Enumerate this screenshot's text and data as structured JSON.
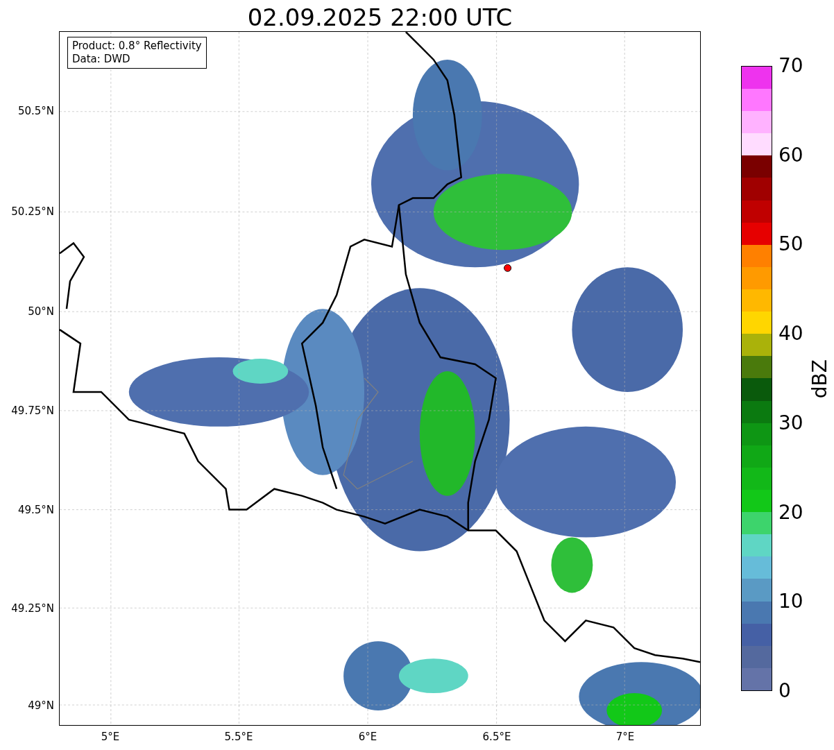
{
  "title": "02.09.2025 22:00 UTC",
  "info_box": [
    "Product: 0.8° Reflectivity",
    "Data: DWD"
  ],
  "map": {
    "lat_ticks": [
      "50.5°N",
      "50.25°N",
      "50°N",
      "49.75°N",
      "49.5°N",
      "49.25°N",
      "49°N"
    ],
    "lon_ticks": [
      "5°E",
      "5.5°E",
      "6°E",
      "6.5°E",
      "7°E"
    ]
  },
  "colorbar": {
    "label": "dBZ",
    "ticks": [
      "70",
      "60",
      "50",
      "40",
      "30",
      "20",
      "10",
      "0"
    ],
    "bins": [
      {
        "color": "#6473a8"
      },
      {
        "color": "#54699e"
      },
      {
        "color": "#4560a5"
      },
      {
        "color": "#4a78b0"
      },
      {
        "color": "#5a9ac4"
      },
      {
        "color": "#66bcd9"
      },
      {
        "color": "#5fd6c4"
      },
      {
        "color": "#3dd46c"
      },
      {
        "color": "#12c818"
      },
      {
        "color": "#12b818"
      },
      {
        "color": "#10a816"
      },
      {
        "color": "#0e9614"
      },
      {
        "color": "#0b7a10"
      },
      {
        "color": "#0a5a0c"
      },
      {
        "color": "#4a7a0c"
      },
      {
        "color": "#aab20a"
      },
      {
        "color": "#ffd600"
      },
      {
        "color": "#ffb800"
      },
      {
        "color": "#ff9a00"
      },
      {
        "color": "#ff8000"
      },
      {
        "color": "#e60000"
      },
      {
        "color": "#c00000"
      },
      {
        "color": "#a00000"
      },
      {
        "color": "#7a0000"
      },
      {
        "color": "#ffdcff"
      },
      {
        "color": "#ffb2ff"
      },
      {
        "color": "#ff77ff"
      },
      {
        "color": "#ee33ee"
      }
    ]
  }
}
